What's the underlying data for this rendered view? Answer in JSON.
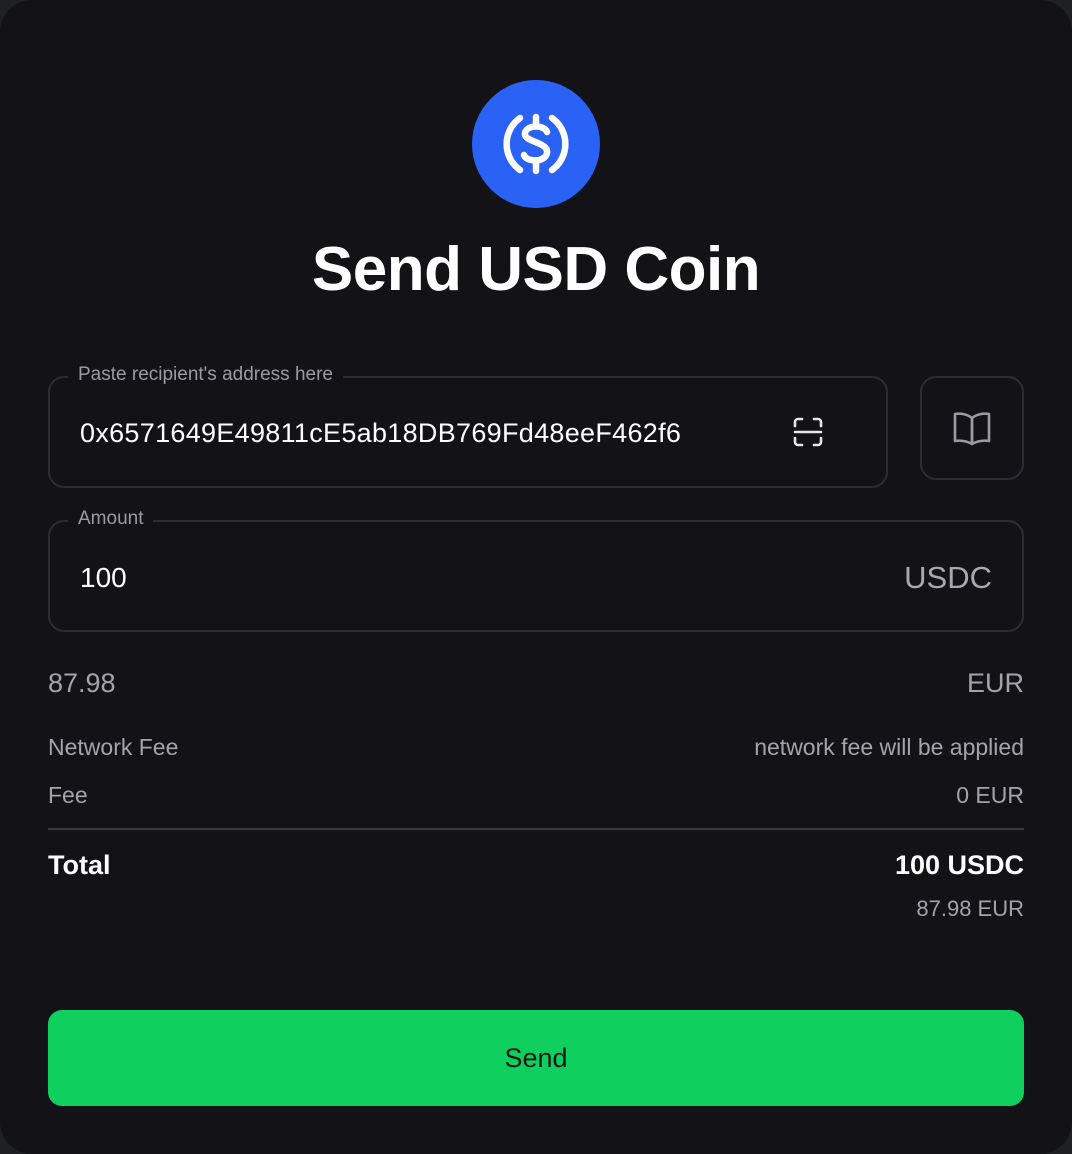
{
  "title": "Send USD Coin",
  "coin": {
    "icon": "usdc-logo-icon",
    "brand_color": "#2a62f6"
  },
  "recipient": {
    "label": "Paste recipient's address here",
    "value": "0x6571649E49811cE5ab18DB769Fd48eeF462f6",
    "scan_icon": "scan-icon",
    "address_book_icon": "book-icon"
  },
  "amount": {
    "label": "Amount",
    "value": "100",
    "unit": "USDC"
  },
  "fiat": {
    "value": "87.98",
    "currency": "EUR"
  },
  "fees": [
    {
      "label": "Network Fee",
      "value": "network fee will be applied"
    },
    {
      "label": "Fee",
      "value": "0 EUR"
    }
  ],
  "total": {
    "label": "Total",
    "value": "100 USDC",
    "fiat": "87.98 EUR"
  },
  "send_button": {
    "label": "Send",
    "color": "#0fcf5e"
  },
  "colors": {
    "background": "#131317",
    "border": "#2c2d33",
    "muted_text": "#a3a4aa"
  }
}
